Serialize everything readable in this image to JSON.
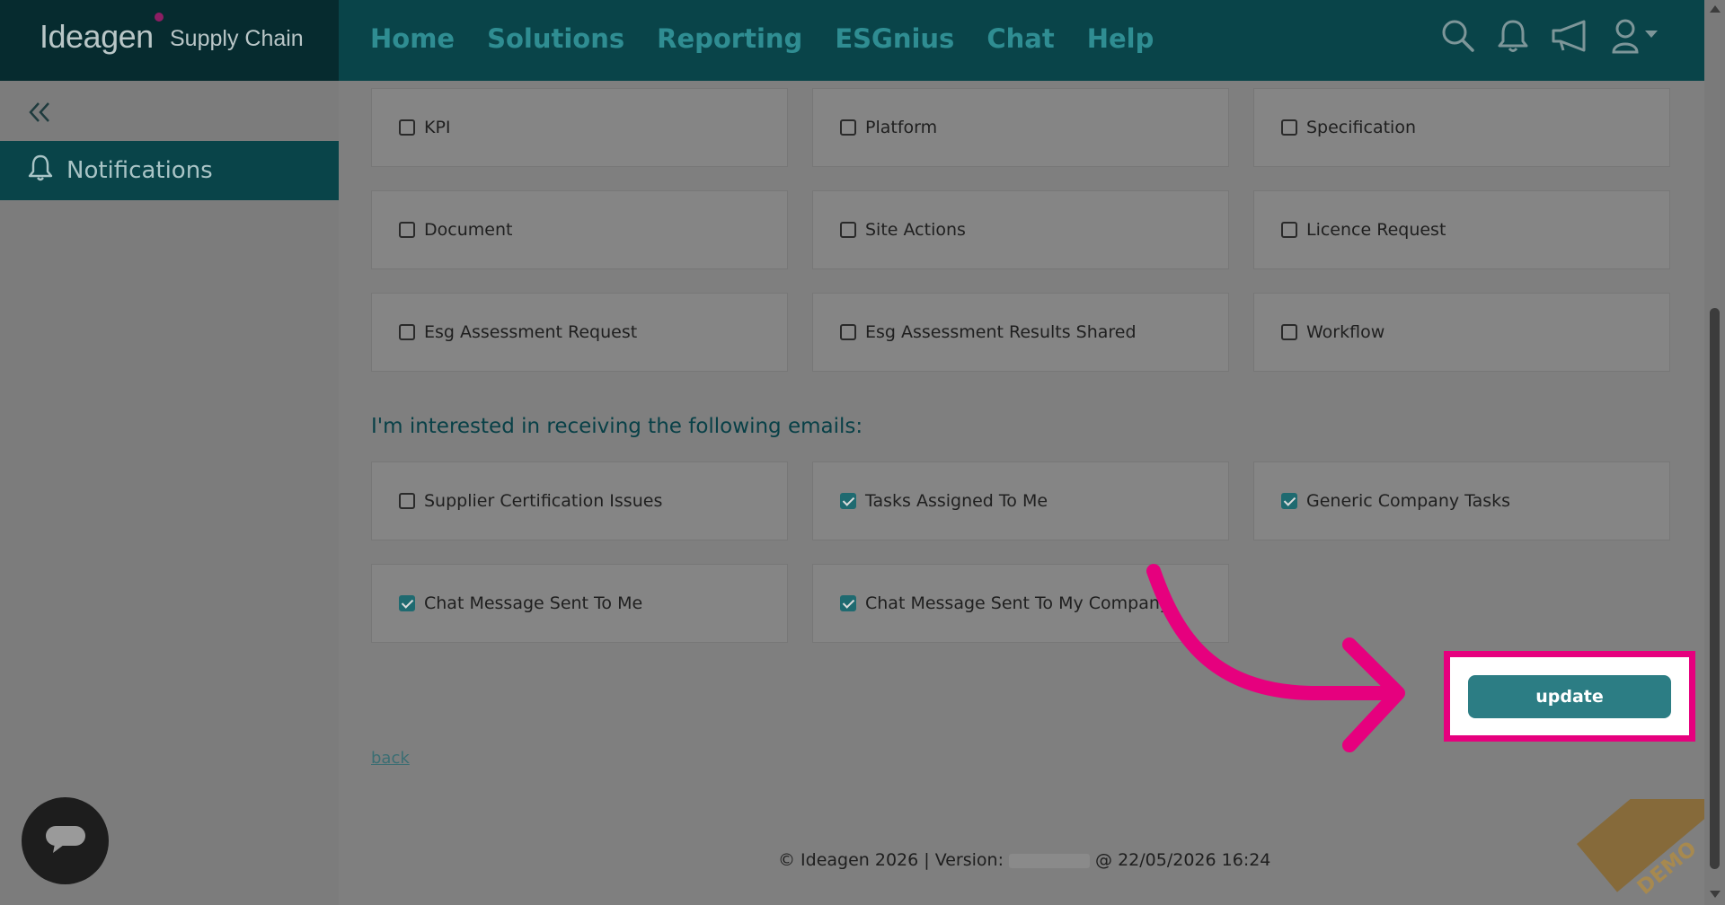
{
  "header": {
    "logo_text": "Ideagen",
    "logo_sub": "Supply Chain",
    "nav": [
      "Home",
      "Solutions",
      "Reporting",
      "ESGnius",
      "Chat",
      "Help"
    ]
  },
  "sidebar": {
    "items": [
      {
        "label": "Notifications",
        "icon": "bell-icon"
      }
    ]
  },
  "platform_notifications": [
    {
      "label": "KPI",
      "checked": false
    },
    {
      "label": "Platform",
      "checked": false
    },
    {
      "label": "Specification",
      "checked": false
    },
    {
      "label": "Document",
      "checked": false
    },
    {
      "label": "Site Actions",
      "checked": false
    },
    {
      "label": "Licence Request",
      "checked": false
    },
    {
      "label": "Esg Assessment Request",
      "checked": false
    },
    {
      "label": "Esg Assessment Results Shared",
      "checked": false
    },
    {
      "label": "Workflow",
      "checked": false
    }
  ],
  "emails": {
    "heading": "I'm interested in receiving the following emails:",
    "items": [
      {
        "label": "Supplier Certification Issues",
        "checked": false
      },
      {
        "label": "Tasks Assigned To Me",
        "checked": true
      },
      {
        "label": "Generic Company Tasks",
        "checked": true
      },
      {
        "label": "Chat Message Sent To Me",
        "checked": true
      },
      {
        "label": "Chat Message Sent To My Company",
        "checked": true
      }
    ]
  },
  "actions": {
    "update_label": "update",
    "back_label": "back"
  },
  "footer": {
    "left": "© Ideagen 2026 | Version: ",
    "right": " @ 22/05/2026 16:24"
  },
  "watermark": "DEMO",
  "colors": {
    "header_bg": "#094449",
    "accent": "#2c7d84",
    "highlight": "#e6007e"
  }
}
